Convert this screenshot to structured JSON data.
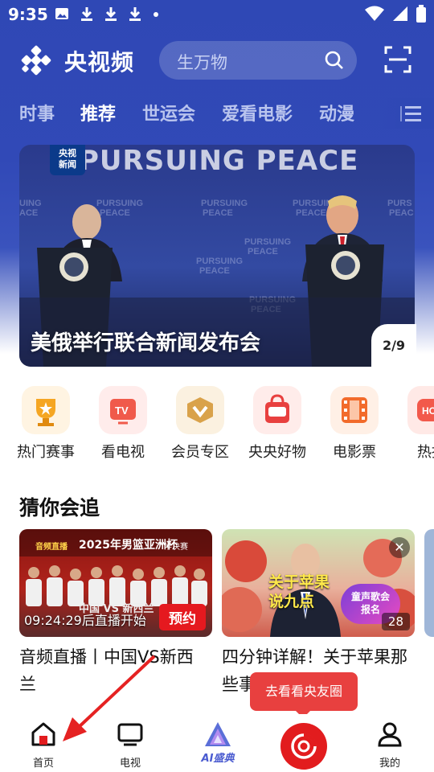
{
  "status_bar": {
    "time": "9:35"
  },
  "header": {
    "app_name": "央视频",
    "search_placeholder": "生万物"
  },
  "tabs": [
    {
      "label": "时事",
      "active": false
    },
    {
      "label": "推荐",
      "active": true
    },
    {
      "label": "世运会",
      "active": false
    },
    {
      "label": "爱看电影",
      "active": false
    },
    {
      "label": "动漫",
      "active": false
    }
  ],
  "banner": {
    "headline": "美俄举行联合新闻发布会",
    "backdrop_text": "PURSUING PEACE",
    "badge": "央视\n新闻",
    "page_indicator": "2/9"
  },
  "quick_entries": [
    {
      "label": "热门赛事",
      "icon": "trophy-icon",
      "color": "#f5a623"
    },
    {
      "label": "看电视",
      "icon": "tv-icon",
      "color": "#f05a4b"
    },
    {
      "label": "会员专区",
      "icon": "vip-icon",
      "color": "#d9a24a"
    },
    {
      "label": "央央好物",
      "icon": "shopping-bag-icon",
      "color": "#e8403f"
    },
    {
      "label": "电影票",
      "icon": "film-icon",
      "color": "#f26b2b"
    },
    {
      "label": "热播",
      "icon": "hot-icon",
      "color": "#f2594b"
    }
  ],
  "section": {
    "title": "猜你会追"
  },
  "cards": [
    {
      "title": "音频直播丨中国VS新西兰",
      "thumb_caption": "2025年男篮亚洲杯",
      "thumb_prefix": "音频直播",
      "thumb_stage": "半决赛",
      "thumb_teams": "中国 VS 新西兰",
      "overlay": "09:24:29后直播开始",
      "action": "预约"
    },
    {
      "title": "四分钟详解！关于苹果那些事",
      "thumb_caption": "关于苹果 说九点",
      "thumb_logo": "童声歌会 报名",
      "count": "28"
    }
  ],
  "tooltip": "去看看央友圈",
  "bottom_nav": [
    {
      "label": "首页",
      "icon": "home-icon"
    },
    {
      "label": "电视",
      "icon": "tv-icon"
    },
    {
      "label": "AI盛典",
      "icon": "ai-logo-icon"
    },
    {
      "label": "",
      "icon": "circle-friends-icon"
    },
    {
      "label": "我的",
      "icon": "profile-icon"
    }
  ]
}
